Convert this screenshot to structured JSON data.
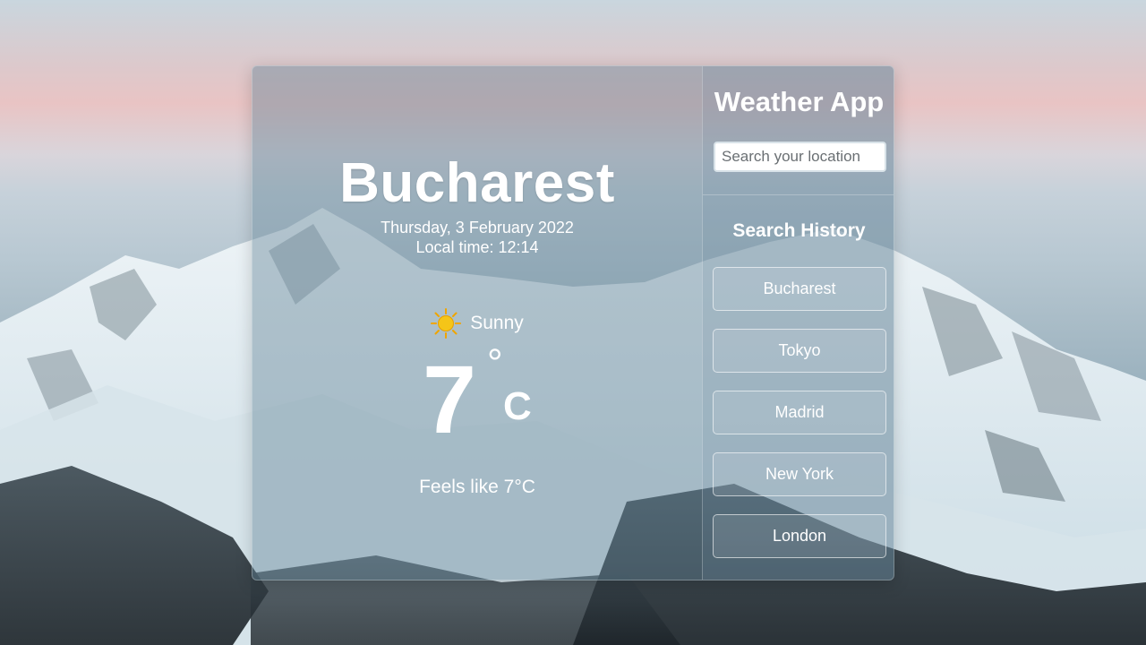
{
  "app": {
    "title": "Weather App"
  },
  "search": {
    "placeholder": "Search your location",
    "value": ""
  },
  "current": {
    "city": "Bucharest",
    "date": "Thursday, 3 February 2022",
    "local_time": "Local time: 12:14",
    "condition": "Sunny",
    "condition_icon": "sun-icon",
    "temperature": "7",
    "degree_symbol": "°",
    "unit": "C",
    "feels_like": "Feels like 7°C"
  },
  "history": {
    "title": "Search History",
    "items": [
      {
        "label": "Bucharest"
      },
      {
        "label": "Tokyo"
      },
      {
        "label": "Madrid"
      },
      {
        "label": "New York"
      },
      {
        "label": "London"
      }
    ]
  },
  "colors": {
    "sun": "#f5c518",
    "sun_rays": "#f0a500",
    "text": "#ffffff"
  }
}
